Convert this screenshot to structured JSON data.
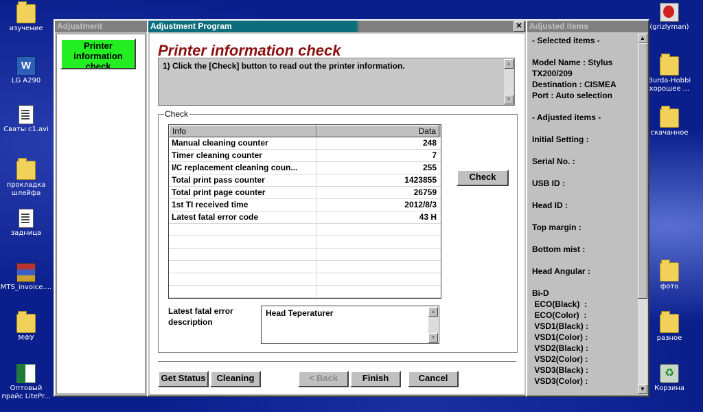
{
  "desktop": {
    "left_icons": [
      {
        "label": "изучение",
        "icon": "folder"
      },
      {
        "label": "LG A290",
        "icon": "word-doc"
      },
      {
        "label": "Сваты с1.avi",
        "icon": "document"
      },
      {
        "label": "прокладка\nшлейфа",
        "icon": "folder"
      },
      {
        "label": "задница",
        "icon": "document"
      },
      {
        "label": "MTS_invoice....",
        "icon": "rar-archive"
      },
      {
        "label": "МФУ",
        "icon": "folder"
      },
      {
        "label": "Оптовый\nпрайс LitePr...",
        "icon": "excel"
      }
    ],
    "right_icons": [
      {
        "label": "(grizlyman)",
        "icon": "shortcut"
      },
      {
        "label": "Burda-Hobbi\nхорошее ...",
        "icon": "folder"
      },
      {
        "label": "скачанное",
        "icon": "folder"
      },
      {
        "label": "фото",
        "icon": "folder"
      },
      {
        "label": "разное",
        "icon": "folder"
      },
      {
        "label": "Корзина",
        "icon": "recycle-bin"
      }
    ]
  },
  "left_panel": {
    "title": "Adjustment",
    "button_label": "Printer information check"
  },
  "main_window": {
    "title": "Adjustment Program",
    "close_label": "✕",
    "heading": "Printer information check",
    "instruction": "1) Click the [Check] button to read out the printer information.",
    "group_label": "Check",
    "table": {
      "columns": [
        "Info",
        "Data"
      ],
      "rows": [
        {
          "info": "Manual cleaning counter",
          "data": "248"
        },
        {
          "info": "Timer cleaning counter",
          "data": "7"
        },
        {
          "info": "I/C replacement cleaning coun...",
          "data": "255"
        },
        {
          "info": "Total print pass counter",
          "data": "1423855"
        },
        {
          "info": "Total print page counter",
          "data": "26759"
        },
        {
          "info": "1st TI received time",
          "data": "2012/8/3"
        },
        {
          "info": "Latest fatal error code",
          "data": "43 H"
        },
        {
          "info": "",
          "data": ""
        },
        {
          "info": "",
          "data": ""
        },
        {
          "info": "",
          "data": ""
        },
        {
          "info": "",
          "data": ""
        },
        {
          "info": "",
          "data": ""
        },
        {
          "info": "",
          "data": ""
        }
      ]
    },
    "check_button": "Check",
    "error_label": "Latest fatal error description",
    "error_value": "Head Teperaturer",
    "buttons": {
      "get_status": "Get Status",
      "cleaning": "Cleaning",
      "back": "< Back",
      "finish": "Finish",
      "cancel": "Cancel"
    }
  },
  "right_panel": {
    "title": "Adjusted items",
    "lines": [
      "- Selected items -",
      "",
      "Model Name : Stylus",
      "TX200/209",
      "Destination : CISMEA",
      "Port : Auto selection",
      "",
      "- Adjusted items -",
      "",
      "Initial Setting :",
      "",
      "Serial No. :",
      "",
      "USB ID :",
      "",
      "Head ID :",
      "",
      "Top margin :",
      "",
      "Bottom mist :",
      "",
      "Head Angular :",
      "",
      "Bi-D",
      " ECO(Black)  :",
      " ECO(Color)  :",
      " VSD1(Black) :",
      " VSD1(Color) :",
      " VSD2(Black) :",
      " VSD2(Color) :",
      " VSD3(Black) :",
      " VSD3(Color) :"
    ]
  },
  "colors": {
    "desktop_bg": "#0a1f8c",
    "active_title": "#0c6e7c",
    "heading": "#8b1010",
    "green_button": "#22ee22",
    "window_face": "#c0c0c0"
  }
}
